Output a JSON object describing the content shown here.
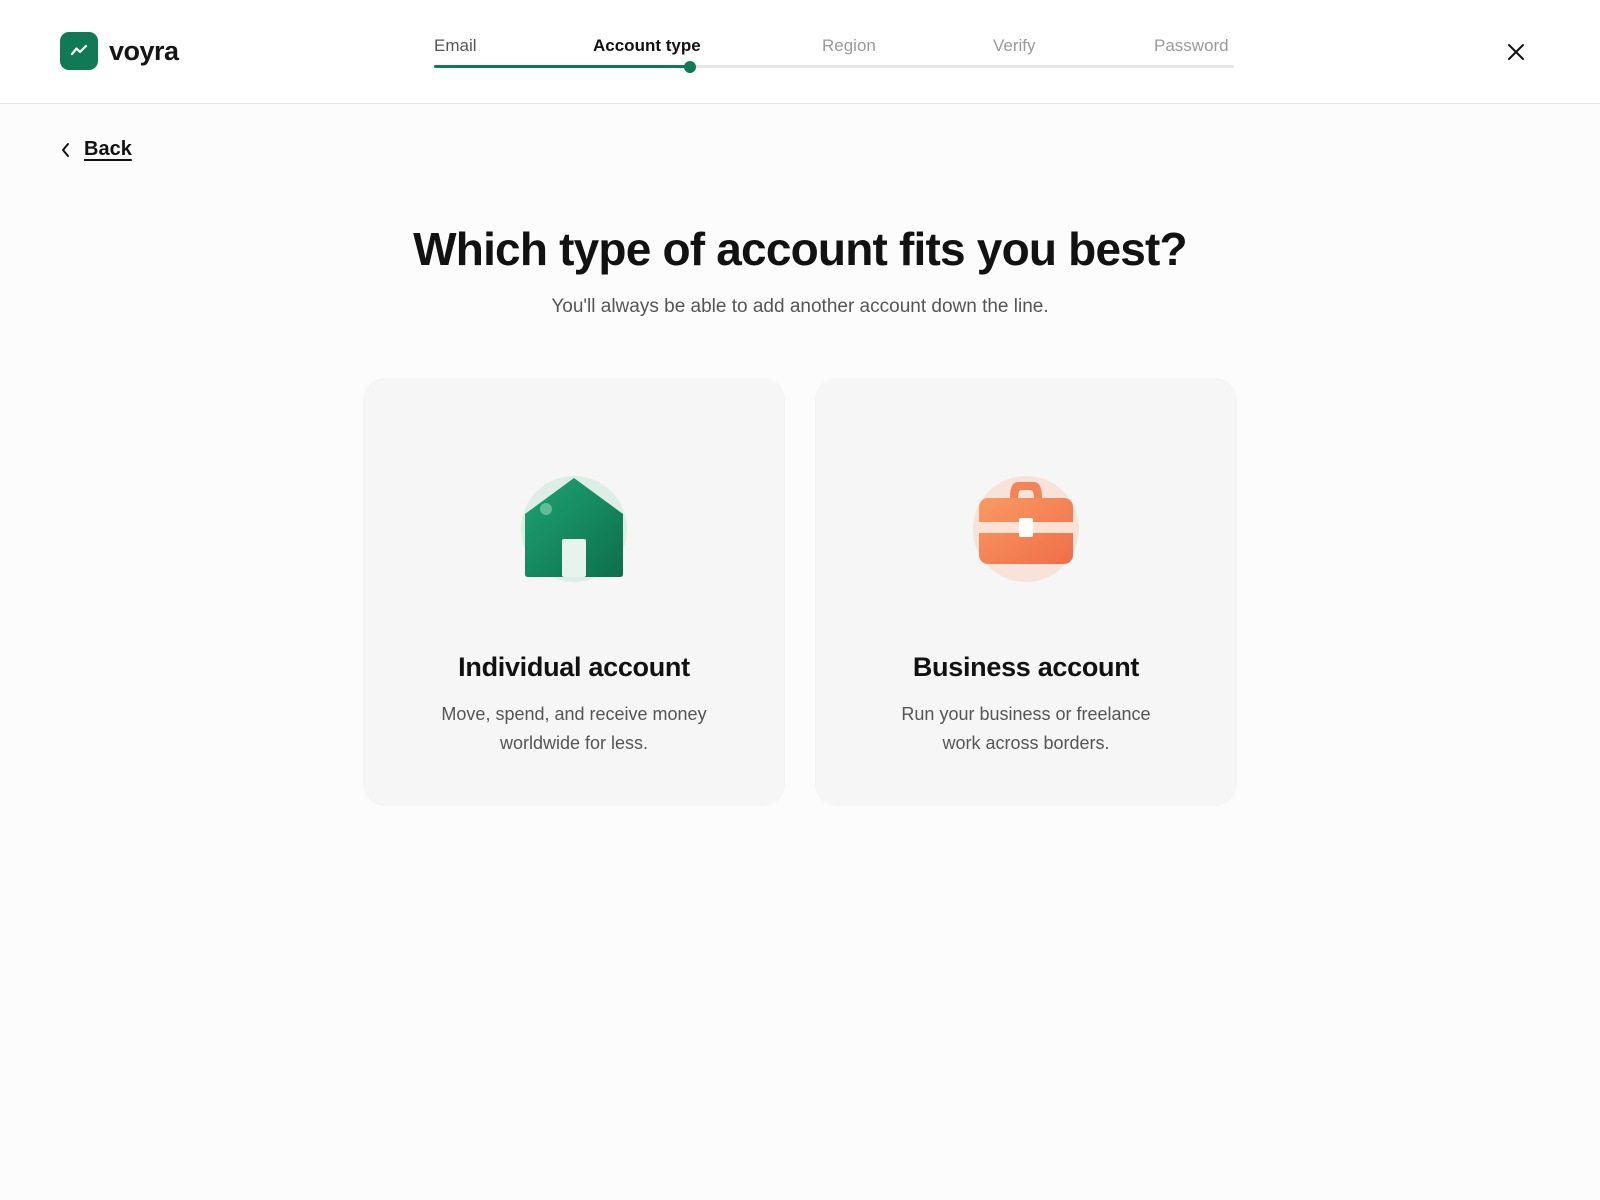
{
  "brand": {
    "name": "voyra",
    "color": "#0f7a55"
  },
  "stepper": {
    "steps": [
      {
        "label": "Email",
        "state": "done"
      },
      {
        "label": "Account type",
        "state": "active"
      },
      {
        "label": "Region",
        "state": "upcoming"
      },
      {
        "label": "Verify",
        "state": "upcoming"
      },
      {
        "label": "Password",
        "state": "upcoming"
      }
    ],
    "progress": 0.32
  },
  "nav": {
    "back_label": "Back"
  },
  "page": {
    "title": "Which type of account fits you best?",
    "subtitle": "You'll always be able to add another account down the line."
  },
  "options": [
    {
      "title": "Individual account",
      "desc_line1": "Move, spend, and receive money",
      "desc_line2": "worldwide for less.",
      "icon": "house-icon",
      "color": "#12895d"
    },
    {
      "title": "Business account",
      "desc_line1": "Run your business or freelance",
      "desc_line2": "work across borders.",
      "icon": "briefcase-icon",
      "color": "#f47f4f"
    }
  ]
}
